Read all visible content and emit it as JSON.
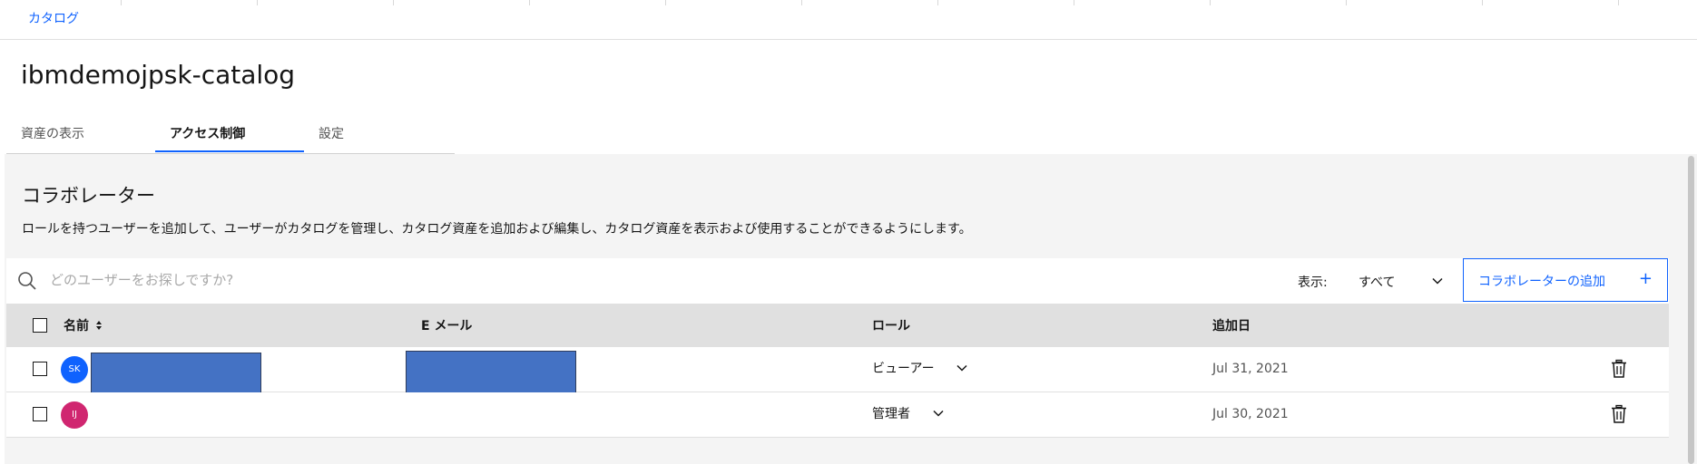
{
  "breadcrumb": {
    "label": "カタログ"
  },
  "page": {
    "title": "ibmdemojpsk-catalog"
  },
  "tabs": [
    {
      "label": "資産の表示",
      "active": false
    },
    {
      "label": "アクセス制御",
      "active": true
    },
    {
      "label": "設定",
      "active": false
    }
  ],
  "section": {
    "title": "コラボレーター",
    "description": "ロールを持つユーザーを追加して、ユーザーがカタログを管理し、カタログ資産を追加および編集し、カタログ資産を表示および使用することができるようにします。"
  },
  "toolbar": {
    "search_placeholder": "どのユーザーをお探しですか?",
    "filter_label": "表示:",
    "filter_value": "すべて",
    "add_label": "コラボレーターの追加",
    "add_plus": "+"
  },
  "table": {
    "headers": {
      "name": "名前",
      "email": "E メール",
      "role": "ロール",
      "added": "追加日"
    },
    "rows": [
      {
        "initials": "SK",
        "avatar_color": "#0f62fe",
        "role": "ビューアー",
        "added": "Jul 31, 2021"
      },
      {
        "initials": "IJ",
        "avatar_color": "#d02670",
        "role": "管理者",
        "added": "Jul 30, 2021"
      }
    ]
  },
  "colors": {
    "accent": "#0f62fe",
    "redaction": "#4472c4",
    "panel": "#f4f4f4"
  },
  "icons": {
    "search": "search-icon",
    "sort": "sort-icon",
    "chevron": "chevron-down-icon",
    "add": "add-icon",
    "delete": "trash-icon"
  }
}
